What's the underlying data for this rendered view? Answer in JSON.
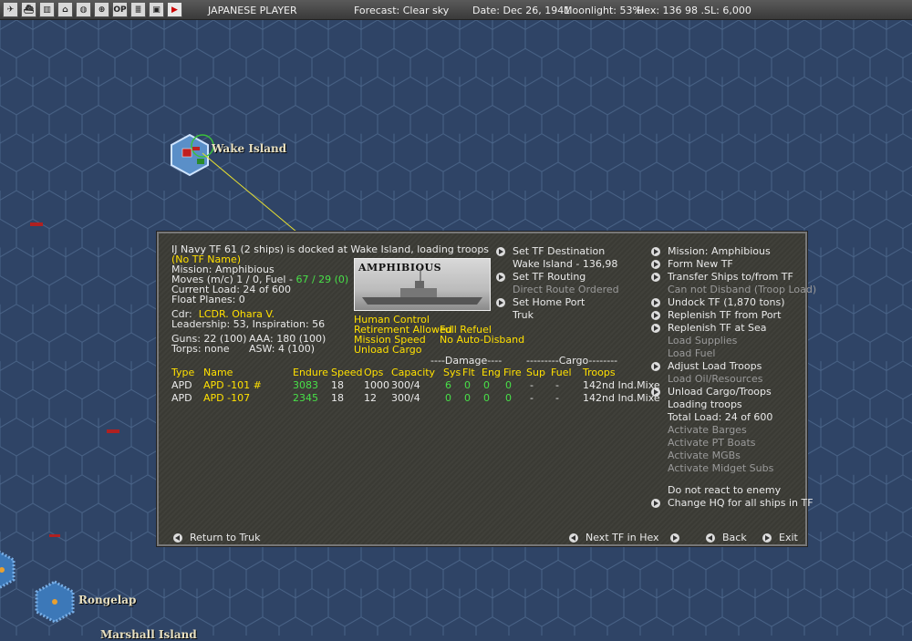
{
  "topbar": {
    "player": "JAPANESE PLAYER",
    "forecast": "Forecast: Clear sky",
    "date": "Date: Dec 26, 1941",
    "moonlight": "Moonlight: 53%",
    "hex": "Hex: 136 98 .SL: 6,000",
    "icons": [
      "aircraft-icon",
      "ship-icon",
      "chart-icon",
      "factory-icon",
      "globe-icon",
      "target-icon",
      "op-icon",
      "list-icon",
      "photo-icon",
      "play-icon"
    ],
    "op_label": "OP"
  },
  "map": {
    "labels": {
      "wake": "Wake Island",
      "rongelap": "Rongelap",
      "marshall": "Marshall Island"
    }
  },
  "tf": {
    "header": "IJ Navy TF 61 (2 ships) is docked at Wake Island, loading troops",
    "name": "(No TF Name)",
    "mission": "Mission: Amphibious",
    "moves_prefix": "Moves (m/c)  1 / 0, Fuel - ",
    "fuel": "67 / 29 (0)",
    "current_load": "Current Load: 24 of 600",
    "float_planes": "Float Planes: 0",
    "cdr_label": "Cdr:",
    "cdr": "LCDR. Ohara V.",
    "leadership": "Leadership: 53, Inspiration: 56",
    "guns": "Guns: 22 (100)",
    "aaa": "AAA: 180 (100)",
    "torps": "Torps: none",
    "asw": "ASW: 4 (100)",
    "photo_label": "AMPHIBIOUS",
    "control": "Human Control",
    "retirement": "Retirement Allowed",
    "refuel": "Full Refuel",
    "speed": "Mission Speed",
    "disband": "No Auto-Disband",
    "unload": "Unload Cargo"
  },
  "table": {
    "damage_header": "----Damage----",
    "cargo_header": "---------Cargo--------",
    "columns": [
      "Type",
      "Name",
      "Endure",
      "Speed",
      "Ops",
      "Capacity",
      "Sys",
      "Flt",
      "Eng",
      "Fire",
      "Sup",
      "Fuel",
      "Troops"
    ],
    "rows": [
      [
        "APD",
        "APD -101 #",
        "3083",
        "18",
        "1000",
        "300/4",
        "6",
        "0",
        "0",
        "0",
        "-",
        "-",
        "142nd Ind.Mixe"
      ],
      [
        "APD",
        "APD -107",
        "2345",
        "18",
        "12",
        "300/4",
        "0",
        "0",
        "0",
        "0",
        "-",
        "-",
        "142nd Ind.Mixe"
      ]
    ]
  },
  "mid_actions": {
    "set_dest": "Set TF Destination",
    "dest_value": "Wake Island - 136,98",
    "set_routing": "Set TF Routing",
    "routing_value": "Direct Route Ordered",
    "set_home": "Set Home Port",
    "home_value": "Truk"
  },
  "right_actions": {
    "mission": "Mission: Amphibious",
    "form": "Form New TF",
    "transfer": "Transfer Ships to/from TF",
    "no_disband": "Can not Disband (Troop Load)",
    "undock": "Undock TF (1,870 tons)",
    "replenish_port": "Replenish TF from Port",
    "replenish_sea": "Replenish TF at Sea",
    "load_supplies": "Load Supplies",
    "load_fuel": "Load Fuel",
    "adjust_troops": "Adjust Load Troops",
    "load_oil": "Load Oil/Resources",
    "unload_cargo": "Unload Cargo/Troops",
    "loading_troops": "Loading troops",
    "total_load": "Total Load: 24 of 600",
    "barges": "Activate Barges",
    "pt_boats": "Activate PT Boats",
    "mgbs": "Activate MGBs",
    "midget": "Activate Midget Subs",
    "no_react": "Do not react to enemy",
    "change_hq": "Change HQ for all ships in TF"
  },
  "footer": {
    "return": "Return to Truk",
    "next_tf": "Next TF in Hex",
    "back": "Back",
    "exit": "Exit"
  },
  "colors": {
    "ocean": "#2f4466",
    "panel": "#3c3c36",
    "highlight": "#ffe000",
    "good": "#48e048"
  }
}
